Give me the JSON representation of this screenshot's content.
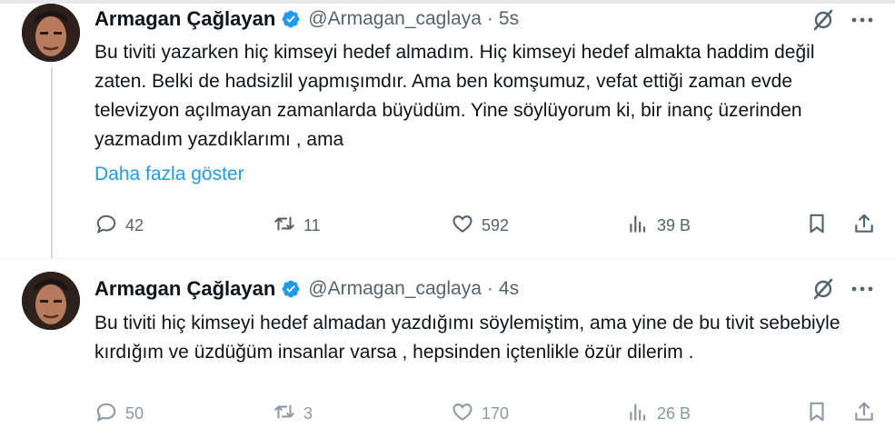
{
  "tweets": [
    {
      "author_name": "Armagan Çağlayan",
      "handle": "@Armagan_caglaya",
      "separator": "·",
      "time": "5s",
      "text": "Bu tiviti yazarken hiç kimseyi hedef almadım. Hiç kimseyi hedef almakta haddim değil zaten. Belki de hadsizlil yapmışımdır. Ama ben komşumuz, vefat ettiği zaman evde televizyon açılmayan zamanlarda büyüdüm. Yine söylüyorum ki, bir inanç üzerinden yazmadım yazdıklarımı , ama",
      "show_more": "Daha fazla göster",
      "replies": "42",
      "retweets": "11",
      "likes": "592",
      "views": "39 B"
    },
    {
      "author_name": "Armagan Çağlayan",
      "handle": "@Armagan_caglaya",
      "separator": "·",
      "time": "4s",
      "text": "Bu tiviti hiç kimseyi hedef almadan yazdığımı söylemiştim, ama yine de bu tivit sebebiyle kırdığım ve üzdüğüm insanlar varsa , hepsinden içtenlikle özür dilerim .",
      "replies": "50",
      "retweets": "3",
      "likes": "170",
      "views": "26 B"
    }
  ],
  "colors": {
    "text": "#0f1419",
    "secondary": "#536471",
    "link": "#1d9bf0",
    "verified": "#1d9bf0",
    "thread_line": "#cfd9de"
  },
  "icons": [
    "verified-badge-icon",
    "grok-icon",
    "more-icon",
    "reply-icon",
    "retweet-icon",
    "like-icon",
    "views-icon",
    "bookmark-icon",
    "share-icon"
  ]
}
